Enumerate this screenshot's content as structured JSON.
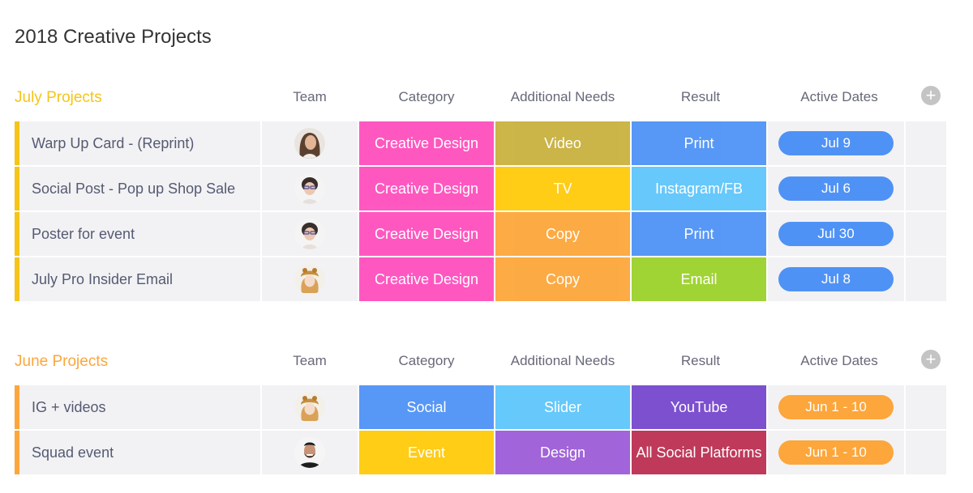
{
  "board": {
    "title": "2018 Creative Projects"
  },
  "columns": {
    "team": "Team",
    "category": "Category",
    "additional_needs": "Additional Needs",
    "result": "Result",
    "active_dates": "Active Dates",
    "add_column_icon": "plus-circle-icon"
  },
  "groups": [
    {
      "name": "July Projects",
      "color": "#f5c518",
      "rows": [
        {
          "name": "Warp Up Card - (Reprint)",
          "team": "woman-long-brown-hair",
          "category": {
            "label": "Creative Design",
            "color": "#ff4fbd"
          },
          "needs": {
            "label": "Video",
            "color": "#c9b13f"
          },
          "result": {
            "label": "Print",
            "color": "#4f92f5"
          },
          "dates": {
            "label": "Jul 9",
            "color": "#4f92f5"
          }
        },
        {
          "name": "Social Post - Pop up Shop Sale",
          "team": "woman-glasses-short-hair",
          "category": {
            "label": "Creative Design",
            "color": "#ff4fbd"
          },
          "needs": {
            "label": "TV",
            "color": "#ffca0a"
          },
          "result": {
            "label": "Instagram/FB",
            "color": "#5ec6fb"
          },
          "dates": {
            "label": "Jul 6",
            "color": "#4f92f5"
          }
        },
        {
          "name": "Poster for event",
          "team": "woman-glasses-short-hair",
          "category": {
            "label": "Creative Design",
            "color": "#ff4fbd"
          },
          "needs": {
            "label": "Copy",
            "color": "#fca63b"
          },
          "result": {
            "label": "Print",
            "color": "#4f92f5"
          },
          "dates": {
            "label": "Jul 30",
            "color": "#4f92f5"
          }
        },
        {
          "name": "July Pro Insider Email",
          "team": "person-animal-hat",
          "category": {
            "label": "Creative Design",
            "color": "#ff4fbd"
          },
          "needs": {
            "label": "Copy",
            "color": "#fca63b"
          },
          "result": {
            "label": "Email",
            "color": "#9bd12a"
          },
          "dates": {
            "label": "Jul 8",
            "color": "#4f92f5"
          }
        }
      ]
    },
    {
      "name": "June Projects",
      "color": "#fca63b",
      "rows": [
        {
          "name": "IG + videos",
          "team": "person-animal-hat",
          "category": {
            "label": "Social",
            "color": "#4f92f5"
          },
          "needs": {
            "label": "Slider",
            "color": "#5ec6fb"
          },
          "result": {
            "label": "YouTube",
            "color": "#7647cc"
          },
          "dates": {
            "label": "Jun 1 - 10",
            "color": "#fca63b"
          }
        },
        {
          "name": "Squad event",
          "team": "man-beard-black-shirt",
          "category": {
            "label": "Event",
            "color": "#ffca0a"
          },
          "needs": {
            "label": "Design",
            "color": "#9c5cd8"
          },
          "result": {
            "label": "All Social Platforms",
            "color": "#bc2f52"
          },
          "dates": {
            "label": "Jun 1 - 10",
            "color": "#fca63b"
          }
        }
      ]
    }
  ]
}
